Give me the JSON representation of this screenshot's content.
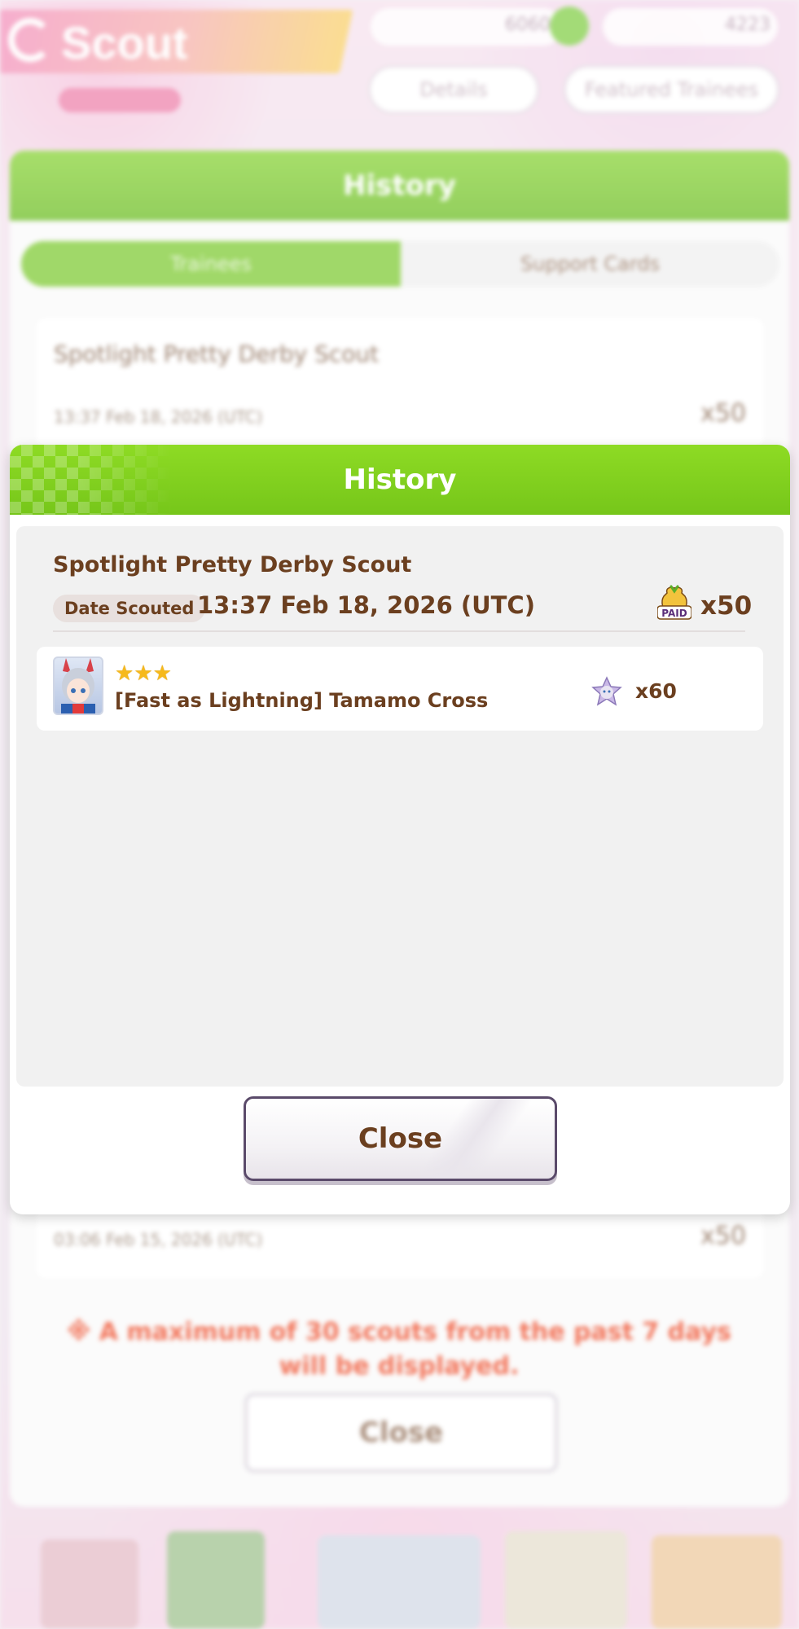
{
  "background": {
    "screen_title": "Scout",
    "top_bar": {
      "left_count": "6060",
      "right_count": "4223"
    },
    "buttons": [
      "Details",
      "Featured Trainees"
    ],
    "panel": {
      "title": "History",
      "tabs": [
        "Trainees",
        "Support Cards"
      ],
      "entries": [
        {
          "scout_name": "Spotlight Pretty Derby Scout",
          "date_label": "Date Scouted",
          "date": "13:37 Feb 18, 2026 (UTC)",
          "cost": "x50"
        },
        {
          "scout_name": "",
          "date_label": "Date Scouted",
          "date": "03:06 Feb 15, 2026 (UTC)",
          "cost": "x50"
        }
      ],
      "note": "※ A maximum of 30 scouts from the past 7 days will be displayed.",
      "close_label": "Close"
    }
  },
  "modal": {
    "title": "History",
    "scout_name": "Spotlight Pretty Derby Scout",
    "date_label": "Date Scouted",
    "date": "13:37 Feb 18, 2026 (UTC)",
    "cost_icon": "paid-carat-icon",
    "cost_badge_text": "PAID",
    "cost": "x50",
    "results": [
      {
        "stars": 3,
        "star_glyph": "★",
        "name": "[Fast as Lightning] Tamamo Cross",
        "reward_icon": "trainee-shard-icon",
        "reward_count": "x60"
      }
    ],
    "close_label": "Close"
  },
  "colors": {
    "header_green": "#7ccb1e",
    "text_brown": "#6b3f1f",
    "star_gold": "#f6b91c",
    "body_gray": "#f1f1f1"
  }
}
